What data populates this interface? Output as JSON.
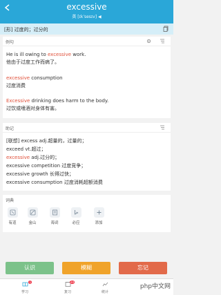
{
  "header": {
    "word": "excessive",
    "phonetic": "英 [ɪkˈsesɪv] ◀"
  },
  "meaning_bar": {
    "text": "[形] 过度的；过分的"
  },
  "examples": {
    "title": "例句",
    "items": [
      {
        "en_before": "He is ill owing to ",
        "highlight": "excessive",
        "en_after": " work.",
        "zh": "他由于过度工作而病了。"
      },
      {
        "en_before": "",
        "highlight": "excessive",
        "en_after": " consumption",
        "zh": "过度消费"
      },
      {
        "en_before": "",
        "highlight": "Excessive",
        "en_after": " drinking does harm to the body.",
        "zh": "过饮或嗜酒对身体有害。"
      }
    ]
  },
  "notes": {
    "title": "助记",
    "lines": [
      {
        "before": "[联想] excess adj.超量的，过量的；",
        "highlight": "",
        "after": ""
      },
      {
        "before": "exceed vt.超过；",
        "highlight": "",
        "after": ""
      },
      {
        "before": "",
        "highlight": "excessive",
        "after": " adj.过分的；"
      },
      {
        "before": "excessive competition 过度竞争；",
        "highlight": "",
        "after": ""
      },
      {
        "before": "excessive growth 长得过快；",
        "highlight": "",
        "after": ""
      },
      {
        "before": "excessive consumption 过度消耗超额消费",
        "highlight": "",
        "after": ""
      }
    ]
  },
  "tools": {
    "title": "词典",
    "items": [
      {
        "label": "有道",
        "icon": "youdao-icon"
      },
      {
        "label": "金山",
        "icon": "kingsoft-icon"
      },
      {
        "label": "海词",
        "icon": "dict-icon"
      },
      {
        "label": "必应",
        "icon": "bing-icon"
      },
      {
        "label": "添加",
        "icon": "add-icon"
      }
    ]
  },
  "actions": {
    "know": "认识",
    "vague": "模糊",
    "forget": "忘记"
  },
  "tabbar": {
    "items": [
      {
        "label": "学习",
        "badge": "1"
      },
      {
        "label": "复习",
        "badge": "20"
      },
      {
        "label": "统计",
        "badge": ""
      }
    ],
    "watermark": "php中文网"
  },
  "colors": {
    "header": "#2aa7d8",
    "know": "#7cc28a",
    "vague": "#f0a32a",
    "forget": "#e26a4a",
    "highlight": "#e0503a"
  }
}
